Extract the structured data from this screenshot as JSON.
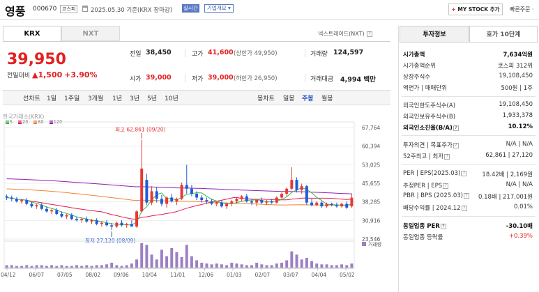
{
  "header": {
    "stock_name": "영풍",
    "stock_code": "000670",
    "market": "코스피",
    "date_text": "2025.05.30 기준(KRX 장마감)",
    "realtime": "실시간",
    "company_overview": "기업개요 ▾",
    "my_stock": "MY STOCK 추가",
    "my_stock_plus": "+",
    "quick_order": "빠른주문 ·"
  },
  "tabs": {
    "krx": "KRX",
    "nxt": "NXT",
    "nextrade": "넥스트레이드(NXT)"
  },
  "quote": {
    "price": "39,950",
    "change_label": "전일대비",
    "change": "▲1,500",
    "change_pct": "+3.90%",
    "prev_label": "전일",
    "prev": "38,450",
    "high_label": "고가",
    "high": "41,600",
    "high_limit": "(상한가 49,950)",
    "volume_label": "거래량",
    "volume": "124,597",
    "open_label": "시가",
    "open": "39,000",
    "low_label": "저가",
    "low": "39,000",
    "low_limit": "(하한가 26,950)",
    "amount_label": "거래대금",
    "amount": "4,994",
    "amount_unit": "백만"
  },
  "period": {
    "items": [
      "선차트",
      "1일",
      "1주일",
      "3개월",
      "1년",
      "3년",
      "5년",
      "10년"
    ],
    "right_items": [
      "봉차트",
      "일봉",
      "주봉",
      "월봉"
    ],
    "active": "주봉"
  },
  "chart_labels": {
    "exchange": "한국거래소(KRX)",
    "legend": [
      {
        "name": "5",
        "color": "#3cb44b"
      },
      {
        "name": "20",
        "color": "#e6194b"
      },
      {
        "name": "60",
        "color": "#f58231"
      },
      {
        "name": "120",
        "color": "#911eb4"
      }
    ],
    "high_annot": "최고 62,861 (09/20)",
    "low_annot": "최저 27,120 (08/09)",
    "volume_label": "거래량"
  },
  "chart_data": {
    "type": "candlestick",
    "ylim": [
      23546,
      67764
    ],
    "y_ticks": [
      67764,
      60394,
      53025,
      45655,
      38285,
      30916,
      23546
    ],
    "y_tick_labels": [
      "67,764",
      "60,394",
      "53,025",
      "45,655",
      "38,285",
      "30,916",
      "23,546"
    ],
    "x_tick_labels": [
      "04/12",
      "06/07",
      "07/05",
      "08/02",
      "09/06",
      "10/04",
      "11/01",
      "12/06",
      "01/03",
      "02/07",
      "03/07",
      "04/04",
      "05/02"
    ],
    "candles": [
      [
        40500,
        41200,
        39000,
        40000
      ],
      [
        40000,
        40800,
        38500,
        39500
      ],
      [
        39500,
        40200,
        38000,
        38500
      ],
      [
        38500,
        39500,
        37500,
        39000
      ],
      [
        39000,
        39800,
        37000,
        37500
      ],
      [
        37500,
        38200,
        36000,
        36500
      ],
      [
        36500,
        37500,
        35500,
        37000
      ],
      [
        37000,
        37800,
        35000,
        35500
      ],
      [
        35500,
        36500,
        34000,
        34500
      ],
      [
        34500,
        35500,
        33500,
        35000
      ],
      [
        35000,
        35800,
        33000,
        33500
      ],
      [
        33500,
        34500,
        32000,
        32500
      ],
      [
        32500,
        33500,
        31500,
        33000
      ],
      [
        33000,
        33800,
        31000,
        31500
      ],
      [
        31500,
        32500,
        30500,
        31000
      ],
      [
        31000,
        32000,
        30000,
        31500
      ],
      [
        31500,
        32500,
        30000,
        30500
      ],
      [
        30500,
        31500,
        29500,
        31000
      ],
      [
        31000,
        31800,
        29000,
        29500
      ],
      [
        29500,
        30500,
        28500,
        30000
      ],
      [
        30000,
        31000,
        28500,
        29000
      ],
      [
        29000,
        30000,
        27120,
        28500
      ],
      [
        28500,
        30500,
        28000,
        30000
      ],
      [
        30000,
        31000,
        28500,
        29000
      ],
      [
        29000,
        30000,
        28000,
        29500
      ],
      [
        29500,
        31000,
        28500,
        28500
      ],
      [
        28500,
        35000,
        28000,
        34500
      ],
      [
        34500,
        62861,
        34000,
        51500
      ],
      [
        47000,
        49500,
        37000,
        38000
      ],
      [
        38000,
        44500,
        37000,
        42500
      ],
      [
        42500,
        44000,
        38000,
        39500
      ],
      [
        39500,
        41000,
        36500,
        37500
      ],
      [
        37500,
        40500,
        36000,
        40000
      ],
      [
        40000,
        41500,
        38000,
        38500
      ],
      [
        38500,
        40000,
        37000,
        39500
      ],
      [
        39500,
        46000,
        39000,
        45000
      ],
      [
        45000,
        53000,
        41500,
        43500
      ],
      [
        43500,
        45000,
        40500,
        41500
      ],
      [
        41500,
        42500,
        39000,
        40000
      ],
      [
        40000,
        41000,
        38000,
        39000
      ],
      [
        39000,
        40000,
        37500,
        38500
      ],
      [
        38500,
        39500,
        37000,
        37500
      ],
      [
        37500,
        38500,
        36500,
        38000
      ],
      [
        38000,
        39000,
        36000,
        36500
      ],
      [
        36500,
        38000,
        35500,
        37500
      ],
      [
        37500,
        39000,
        36500,
        38500
      ],
      [
        38500,
        40000,
        37500,
        39500
      ],
      [
        39500,
        41000,
        38500,
        40500
      ],
      [
        40500,
        41500,
        38000,
        38500
      ],
      [
        38500,
        39500,
        37000,
        38000
      ],
      [
        38000,
        39000,
        36500,
        39000
      ],
      [
        39000,
        40000,
        37500,
        38000
      ],
      [
        38000,
        39000,
        37000,
        38500
      ],
      [
        38500,
        39500,
        37500,
        38000
      ],
      [
        38000,
        40500,
        37500,
        40000
      ],
      [
        40000,
        42000,
        39500,
        41500
      ],
      [
        41500,
        44000,
        40500,
        43500
      ],
      [
        43500,
        52000,
        43000,
        47000
      ],
      [
        47000,
        48000,
        42000,
        43000
      ],
      [
        43000,
        45500,
        41500,
        44500
      ],
      [
        44500,
        45000,
        37000,
        38000
      ],
      [
        38000,
        39500,
        36500,
        37000
      ],
      [
        37000,
        38500,
        36500,
        38000
      ],
      [
        38000,
        38500,
        36000,
        36500
      ],
      [
        36500,
        38000,
        36000,
        37500
      ],
      [
        37500,
        38000,
        36500,
        37000
      ],
      [
        37000,
        38000,
        36000,
        36500
      ],
      [
        36500,
        38000,
        36000,
        37500
      ],
      [
        37500,
        38500,
        35500,
        36000
      ],
      [
        36500,
        41600,
        36000,
        39950
      ]
    ],
    "volume": [
      3,
      3,
      2,
      2,
      3,
      2,
      3,
      3,
      2,
      3,
      2,
      3,
      2,
      2,
      3,
      2,
      3,
      2,
      3,
      3,
      4,
      6,
      3,
      2,
      3,
      5,
      10,
      30,
      28,
      16,
      10,
      22,
      14,
      24,
      19,
      13,
      28,
      14,
      9,
      6,
      5,
      4,
      5,
      4,
      3,
      6,
      5,
      4,
      3,
      3,
      6,
      4,
      3,
      3,
      5,
      6,
      9,
      20,
      16,
      10,
      12,
      8,
      5,
      4,
      4,
      3,
      3,
      4,
      3,
      5
    ]
  },
  "side": {
    "tab1": "투자정보",
    "tab2": "호가 10단계",
    "market_cap_label": "시가총액",
    "market_cap": "7,634억원",
    "rank_label": "시가총액순위",
    "rank": "코스피 312위",
    "shares_label": "상장주식수",
    "shares": "19,108,450",
    "par_label": "액면가 | 매매단위",
    "par": "500원 | 1주",
    "foreign_limit_label": "외국인한도주식수(A)",
    "foreign_limit": "19,108,450",
    "foreign_hold_label": "외국인보유주식수(B)",
    "foreign_hold": "1,933,378",
    "foreign_ratio_label": "외국인소진율(B/A)",
    "foreign_ratio": "10.12%",
    "opinion_label": "투자의견 | 목표주가",
    "opinion": "N/A | N/A",
    "week52_label": "52주최고 | 최저",
    "week52": "62,861 | 27,120",
    "per_label": "PER | EPS(2025.03)",
    "per": "18.42배 | 2,169원",
    "est_per_label": "추정PER | EPS",
    "est_per": "N/A | N/A",
    "pbr_label": "PBR | BPS (2025.03)",
    "pbr": "0.18배 | 217,001원",
    "div_label": "배당수익률 | 2024.12",
    "div": "0.01%",
    "ind_per_label": "동일업종 PER",
    "ind_per": "-30.10배",
    "ind_rate_label": "동일업종 등락률",
    "ind_rate": "+0.39%"
  }
}
